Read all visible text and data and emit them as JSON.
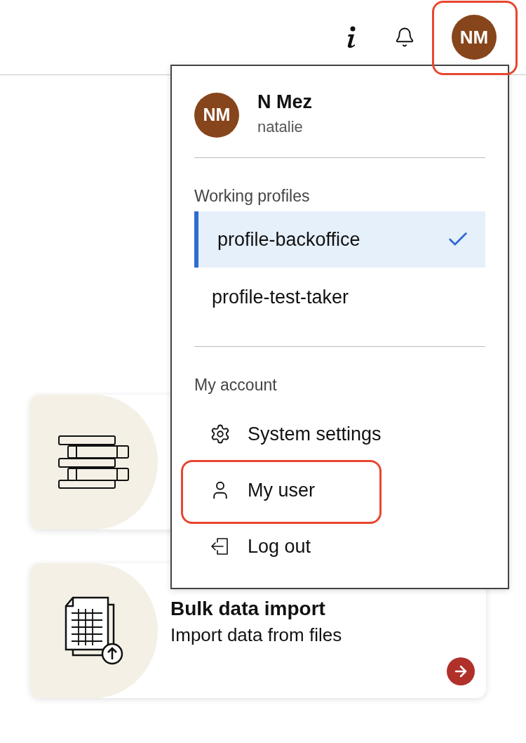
{
  "top_bar": {
    "avatar_initials": "NM"
  },
  "user_menu": {
    "avatar_initials": "NM",
    "name": "N Mez",
    "username": "natalie",
    "profiles_heading": "Working profiles",
    "profiles": [
      {
        "label": "profile-backoffice",
        "selected": true
      },
      {
        "label": "profile-test-taker",
        "selected": false
      }
    ],
    "account_heading": "My account",
    "account_items": [
      {
        "kind": "settings",
        "label": "System settings"
      },
      {
        "kind": "user",
        "label": "My user"
      },
      {
        "kind": "logout",
        "label": "Log out"
      }
    ]
  },
  "cards": [
    {
      "kind": "books"
    },
    {
      "kind": "import",
      "title": "Bulk data import",
      "description": "Import data from files"
    }
  ]
}
